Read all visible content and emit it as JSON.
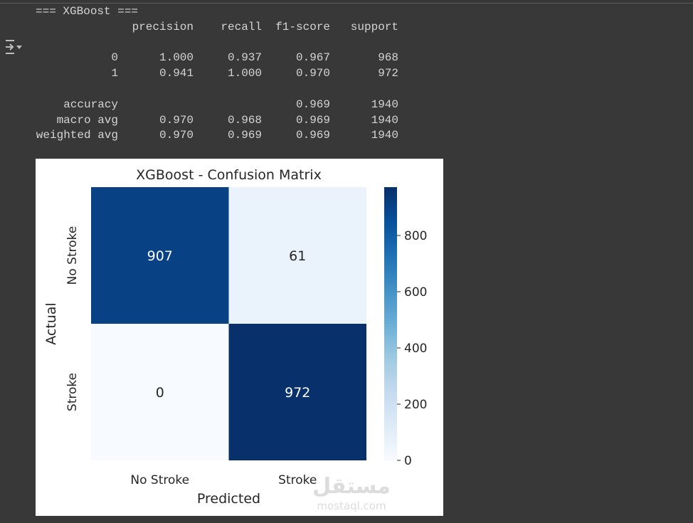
{
  "report": {
    "title": "=== XGBoost ===",
    "headers": [
      "",
      "precision",
      "recall",
      "f1-score",
      "support"
    ],
    "rows": [
      [
        "0",
        "1.000",
        "0.937",
        "0.967",
        "968"
      ],
      [
        "1",
        "0.941",
        "1.000",
        "0.970",
        "972"
      ],
      null,
      [
        "accuracy",
        "",
        "",
        "0.969",
        "1940"
      ],
      [
        "macro avg",
        "0.970",
        "0.968",
        "0.969",
        "1940"
      ],
      [
        "weighted avg",
        "0.970",
        "0.969",
        "0.969",
        "1940"
      ]
    ]
  },
  "output_icon": "output-toggle-icon",
  "chart_data": {
    "type": "heatmap",
    "title": "XGBoost - Confusion Matrix",
    "xlabel": "Predicted",
    "ylabel": "Actual",
    "x_categories": [
      "No Stroke",
      "Stroke"
    ],
    "y_categories": [
      "No Stroke",
      "Stroke"
    ],
    "values": [
      [
        907,
        61
      ],
      [
        0,
        972
      ]
    ],
    "colormap": "Blues",
    "colorbar": {
      "range": [
        0,
        972
      ],
      "ticks": [
        0,
        200,
        400,
        600,
        800
      ]
    }
  },
  "watermark": {
    "arabic": "مستقل",
    "latin": "mostaql.com"
  }
}
